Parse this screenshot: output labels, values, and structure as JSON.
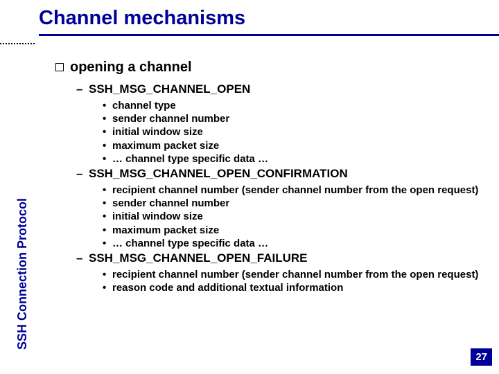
{
  "title": "Channel mechanisms",
  "sidebar": "SSH Connection Protocol",
  "page_number": "27",
  "section": "opening a channel",
  "msgs": [
    {
      "name": "SSH_MSG_CHANNEL_OPEN",
      "items": [
        "channel type",
        "sender channel number",
        "initial window size",
        "maximum packet size",
        "… channel type specific data …"
      ]
    },
    {
      "name": "SSH_MSG_CHANNEL_OPEN_CONFIRMATION",
      "items": [
        "recipient channel number (sender channel number from the open request)",
        "sender channel number",
        "initial window size",
        "maximum packet size",
        "… channel type specific data …"
      ]
    },
    {
      "name": "SSH_MSG_CHANNEL_OPEN_FAILURE",
      "items": [
        "recipient channel number (sender channel number from the open request)",
        "reason code and additional textual information"
      ]
    }
  ]
}
